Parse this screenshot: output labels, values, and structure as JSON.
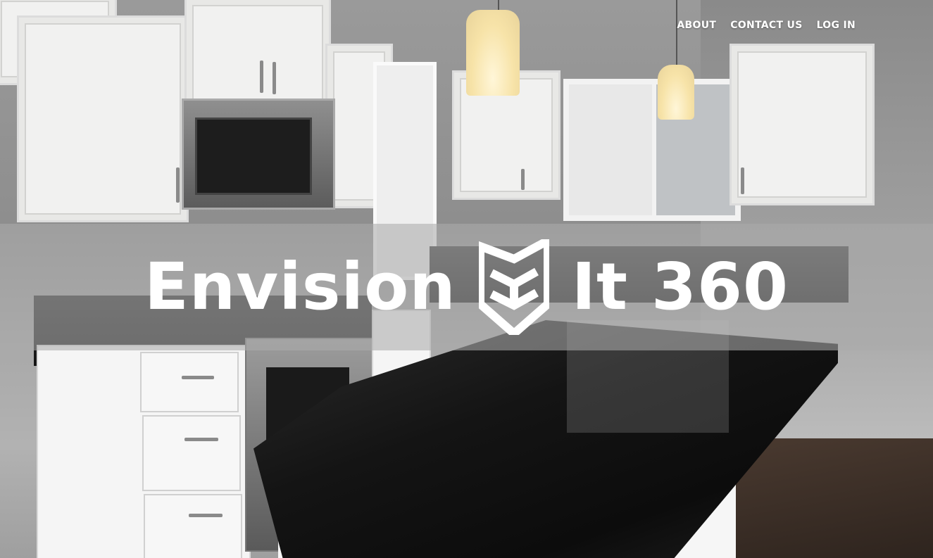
{
  "nav": {
    "items": [
      {
        "label": "ABOUT"
      },
      {
        "label": "CONTACT US"
      },
      {
        "label": "LOG IN"
      }
    ]
  },
  "hero": {
    "brand_left": "Envision",
    "brand_right": "It 360",
    "logo_icon": "shield-chevron-logo-icon",
    "background": "kitchen-photo"
  },
  "colors": {
    "banner_overlay": "#aaaaaa",
    "text": "#ffffff"
  }
}
